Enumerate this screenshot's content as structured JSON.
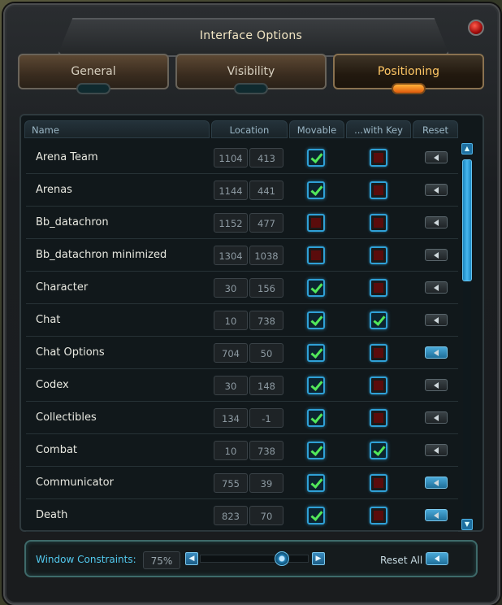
{
  "window": {
    "title": "Interface Options"
  },
  "tabs": [
    {
      "label": "General",
      "active": false
    },
    {
      "label": "Visibility",
      "active": false
    },
    {
      "label": "Positioning",
      "active": true
    }
  ],
  "table": {
    "headers": {
      "name": "Name",
      "location": "Location",
      "movable": "Movable",
      "with_key": "...with Key",
      "reset": "Reset"
    },
    "rows": [
      {
        "name": "Arena Team",
        "x": "1104",
        "y": "413",
        "movable": true,
        "with_key": false,
        "reset_highlighted": false
      },
      {
        "name": "Arenas",
        "x": "1144",
        "y": "441",
        "movable": true,
        "with_key": false,
        "reset_highlighted": false
      },
      {
        "name": "Bb_datachron",
        "x": "1152",
        "y": "477",
        "movable": false,
        "with_key": false,
        "reset_highlighted": false
      },
      {
        "name": "Bb_datachron minimized",
        "x": "1304",
        "y": "1038",
        "movable": false,
        "with_key": false,
        "reset_highlighted": false
      },
      {
        "name": "Character",
        "x": "30",
        "y": "156",
        "movable": true,
        "with_key": false,
        "reset_highlighted": false
      },
      {
        "name": "Chat",
        "x": "10",
        "y": "738",
        "movable": true,
        "with_key": true,
        "reset_highlighted": false
      },
      {
        "name": "Chat Options",
        "x": "704",
        "y": "50",
        "movable": true,
        "with_key": false,
        "reset_highlighted": true
      },
      {
        "name": "Codex",
        "x": "30",
        "y": "148",
        "movable": true,
        "with_key": false,
        "reset_highlighted": false
      },
      {
        "name": "Collectibles",
        "x": "134",
        "y": "-1",
        "movable": true,
        "with_key": false,
        "reset_highlighted": false
      },
      {
        "name": "Combat",
        "x": "10",
        "y": "738",
        "movable": true,
        "with_key": true,
        "reset_highlighted": false
      },
      {
        "name": "Communicator",
        "x": "755",
        "y": "39",
        "movable": true,
        "with_key": false,
        "reset_highlighted": true
      },
      {
        "name": "Death",
        "x": "823",
        "y": "70",
        "movable": true,
        "with_key": false,
        "reset_highlighted": true
      }
    ]
  },
  "footer": {
    "constraints_label": "Window Constraints:",
    "constraints_value": "75%",
    "slider_fraction": 0.75,
    "reset_all_label": "Reset All"
  },
  "colors": {
    "accent": "#2fa0d6",
    "active_tab_text": "#ffc765",
    "check_green": "#52e85a",
    "label_blue": "#52c9ee"
  }
}
